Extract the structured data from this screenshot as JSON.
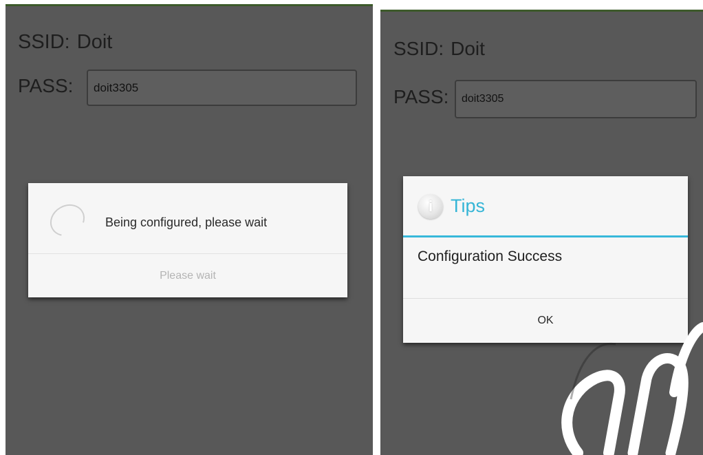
{
  "left_screen": {
    "ssid_label": "SSID:",
    "ssid_value": "Doit",
    "pass_label": "PASS:",
    "pass_value": "doit3305",
    "progress_dialog": {
      "message": "Being configured, please wait",
      "button_label": "Please wait"
    }
  },
  "right_screen": {
    "ssid_label": "SSID:",
    "ssid_value": "Doit",
    "pass_label": "PASS:",
    "pass_value": "doit3305",
    "tips_dialog": {
      "icon_glyph": "i",
      "title": "Tips",
      "message": "Configuration Success",
      "ok_label": "OK"
    }
  },
  "icons": {
    "spinner": "loading-spinner-icon",
    "info": "info-icon"
  },
  "colors": {
    "screen_background": "#585858",
    "dialog_background": "#f6f6f6",
    "accent": "#35b5d6",
    "top_bar": "#3d5a2b"
  }
}
